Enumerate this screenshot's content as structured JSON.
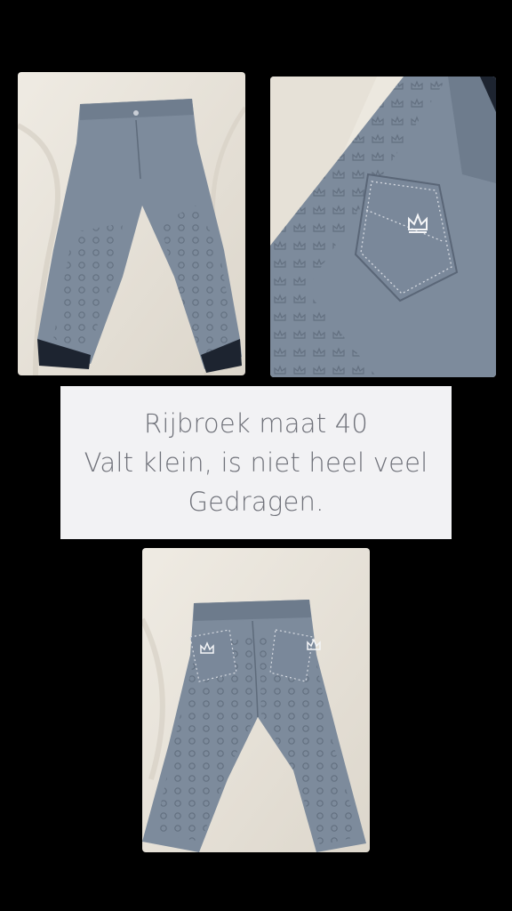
{
  "story": {
    "caption_lines": [
      "Rijbroek maat 40",
      "Valt klein, is niet heel veel",
      "Gedragen."
    ]
  },
  "photos": [
    {
      "subject": "riding breeches front view",
      "icon": "breeches-front-image"
    },
    {
      "subject": "back pocket with crown logo close-up",
      "icon": "breeches-pocket-image"
    },
    {
      "subject": "riding breeches back view",
      "icon": "breeches-back-image"
    }
  ],
  "colors": {
    "background": "#000000",
    "caption_bg": "#f2f2f4",
    "caption_text": "#6f7179",
    "fabric": "#7d8b9c",
    "sheet": "#ece8df"
  }
}
